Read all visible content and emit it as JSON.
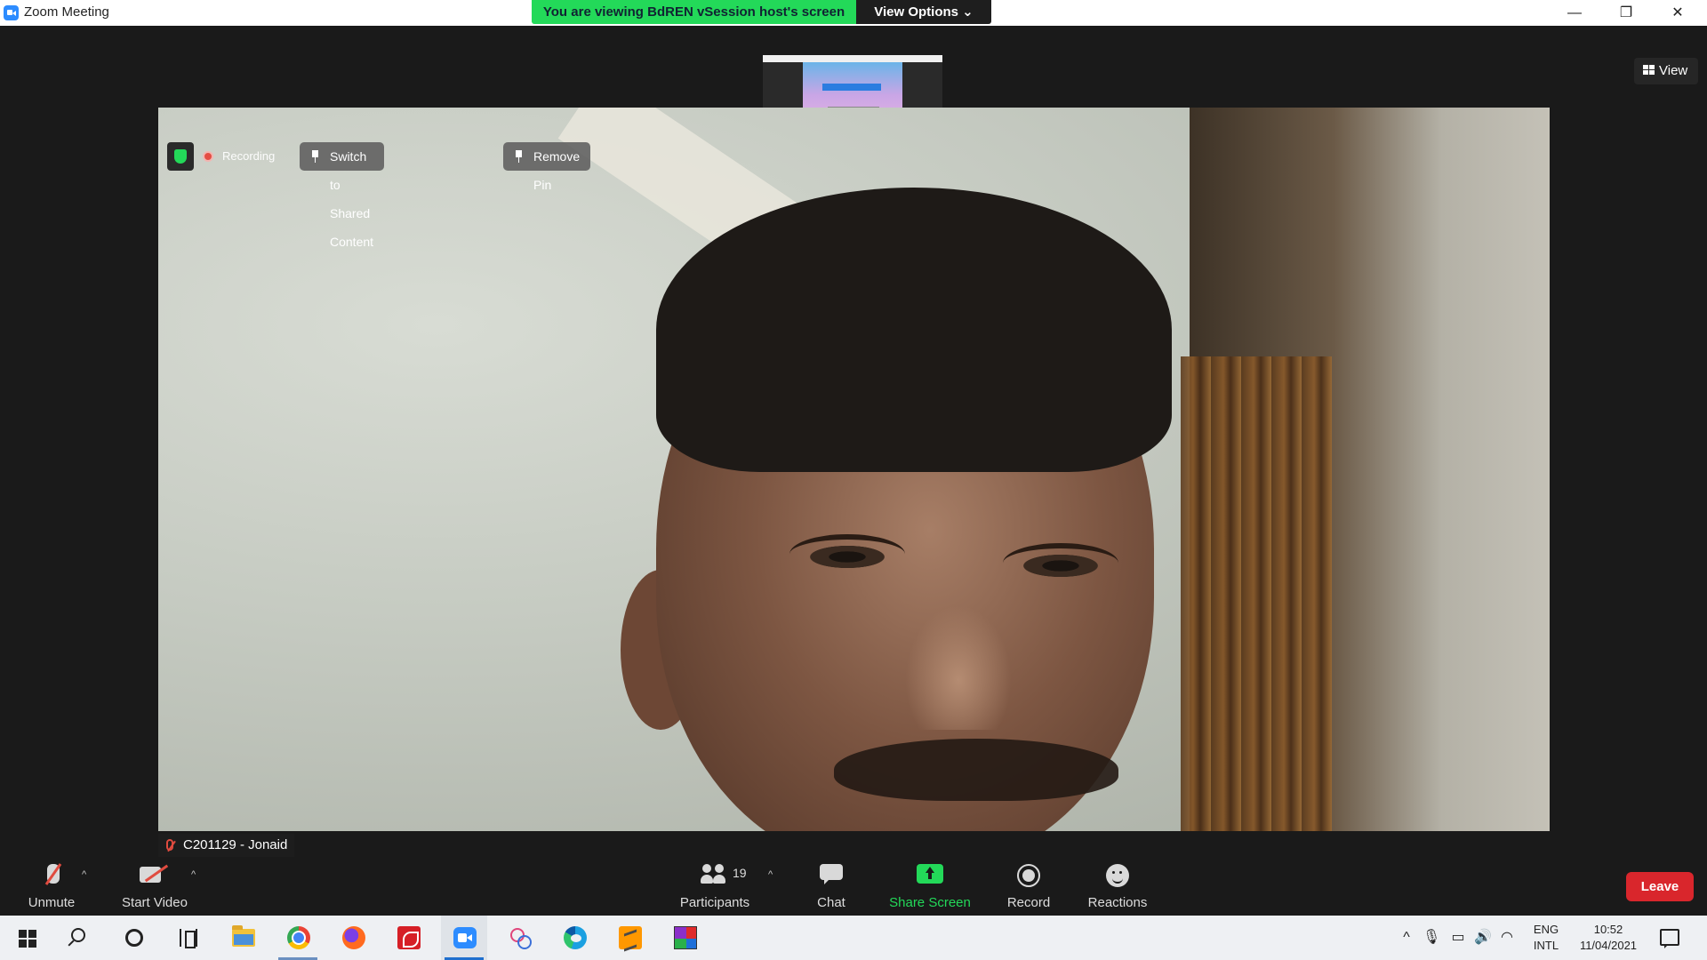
{
  "window": {
    "title": "Zoom Meeting",
    "minimize_glyph": "—",
    "restore_glyph": "❐",
    "close_glyph": "✕"
  },
  "banner": {
    "viewing_text": "You are viewing BdREN vSession host's screen",
    "view_options_label": "View Options ⌄",
    "color": "#23d959"
  },
  "view_button": {
    "label": "View"
  },
  "video_toolbar": {
    "recording_label": "Recording",
    "switch_label": "Switch to Shared Content",
    "remove_pin_label": "Remove Pin"
  },
  "participant": {
    "name": "C201129 - Jonaid",
    "muted": true
  },
  "controls": {
    "unmute_label": "Unmute",
    "start_video_label": "Start Video",
    "participants_label": "Participants",
    "participants_count": "19",
    "chat_label": "Chat",
    "share_screen_label": "Share Screen",
    "record_label": "Record",
    "reactions_label": "Reactions",
    "leave_label": "Leave",
    "caret": "^"
  },
  "taskbar": {
    "apps": [
      "start-icon",
      "search-icon",
      "cortana-icon",
      "task-view-icon",
      "file-explorer-icon",
      "chrome-icon",
      "firefox-icon",
      "acrobat-icon",
      "zoom-icon",
      "snip-sketch-icon",
      "edge-icon",
      "sublime-text-icon",
      "winrar-icon"
    ],
    "tray": {
      "lang_line1": "ENG",
      "lang_line2": "INTL",
      "time": "10:52",
      "date": "11/04/2021",
      "chevron": "^",
      "mic_glyph": "🎙",
      "battery_glyph": "▭",
      "volume_glyph": "🔊",
      "wifi_glyph": "◠"
    }
  },
  "colors": {
    "accent_green": "#23d959",
    "leave_red": "#d9262c",
    "mute_red": "#e04b3f",
    "zoom_blue": "#2d8cff"
  }
}
